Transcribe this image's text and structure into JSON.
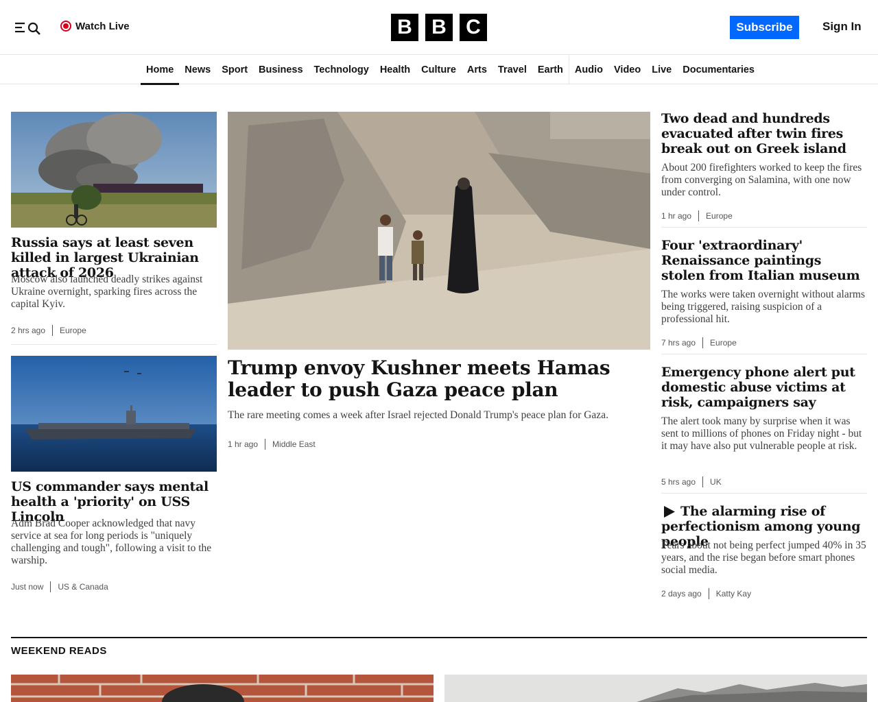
{
  "header": {
    "watch_live": "Watch Live",
    "logo_letters": [
      "B",
      "B",
      "C"
    ],
    "subscribe": "Subscribe",
    "sign_in": "Sign In"
  },
  "nav": {
    "items": [
      "Home",
      "News",
      "Sport",
      "Business",
      "Technology",
      "Health",
      "Culture",
      "Arts",
      "Travel",
      "Earth",
      "Audio",
      "Video",
      "Live",
      "Documentaries"
    ],
    "active": "Home"
  },
  "stories": {
    "left_top": {
      "headline": "Russia says at least seven killed in largest Ukrainian attack of 2026",
      "summary": "Moscow also launched deadly strikes against Ukraine overnight, sparking fires across the capital Kyiv.",
      "time": "2 hrs ago",
      "tag": "Europe"
    },
    "left_bottom": {
      "headline": "US commander says mental health a 'priority' on USS Lincoln",
      "summary": "Adm Brad Cooper acknowledged that navy service at sea for long periods is \"uniquely challenging and tough\", following a visit to the warship.",
      "time": "Just now",
      "tag": "US & Canada"
    },
    "main": {
      "headline": "Trump envoy Kushner meets Hamas leader to push Gaza peace plan",
      "summary": "The rare meeting comes a week after Israel rejected Donald Trump's peace plan for Gaza.",
      "time": "1 hr ago",
      "tag": "Middle East"
    },
    "right": [
      {
        "headline": "Two dead and hundreds evacuated after twin fires break out on Greek island",
        "summary": "About 200 firefighters worked to keep the fires from converging on Salamina, with one now under control.",
        "time": "1 hr ago",
        "tag": "Europe"
      },
      {
        "headline": "Four 'extraordinary' Renaissance paintings stolen from Italian museum",
        "summary": "The works were taken overnight without alarms being triggered, raising suspicion of a professional hit.",
        "time": "7 hrs ago",
        "tag": "Europe"
      },
      {
        "headline": "Emergency phone alert put domestic abuse victims at risk, campaigners say",
        "summary": "The alert took many by surprise when it was sent to millions of phones on Friday night - but it may have also put vulnerable people at risk.",
        "time": "5 hrs ago",
        "tag": "UK"
      },
      {
        "headline": "The alarming rise of perfectionism among young people",
        "summary": "Fears about not being perfect jumped 40% in 35 years, and the rise began before smart phones social media.",
        "time": "2 days ago",
        "tag": "Katty Kay"
      }
    ]
  },
  "sections": {
    "weekend_reads": "WEEKEND READS"
  },
  "colors": {
    "accent": "#0068ff",
    "live": "#d4001e",
    "text": "#141414"
  }
}
